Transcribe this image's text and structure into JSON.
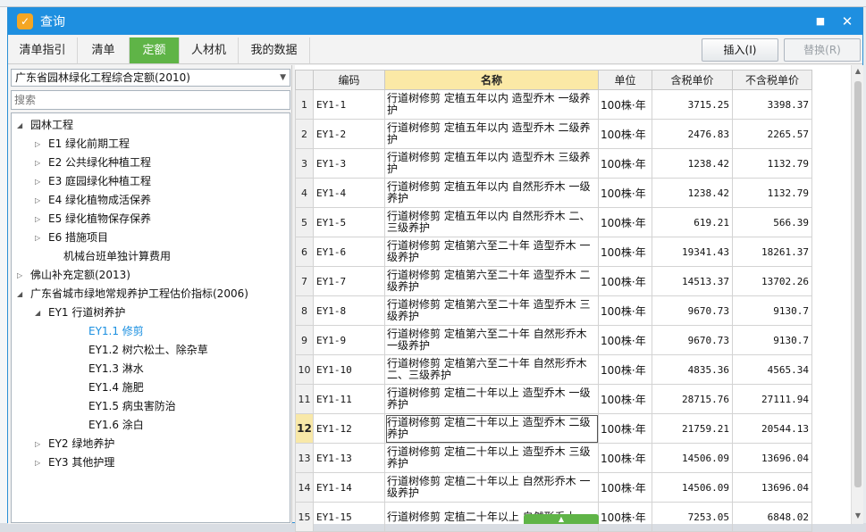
{
  "window": {
    "title": "查询",
    "minimize_glyph": "■",
    "close_glyph": "✕",
    "icon_glyph": "✓"
  },
  "tabs": [
    "清单指引",
    "清单",
    "定额",
    "人材机",
    "我的数据"
  ],
  "active_tab": 2,
  "buttons": {
    "insert": "插入(I)",
    "replace": "替换(R)"
  },
  "library": {
    "selected": "广东省园林绿化工程综合定额(2010)"
  },
  "search": {
    "placeholder": "搜索"
  },
  "tree": [
    {
      "label": "园林工程",
      "level": 0,
      "arrow": "◢"
    },
    {
      "label": "E1 绿化前期工程",
      "level": 1,
      "arrow": "▷"
    },
    {
      "label": "E2 公共绿化种植工程",
      "level": 1,
      "arrow": "▷"
    },
    {
      "label": "E3 庭园绿化种植工程",
      "level": 1,
      "arrow": "▷"
    },
    {
      "label": "E4 绿化植物成活保养",
      "level": 1,
      "arrow": "▷"
    },
    {
      "label": "E5 绿化植物保存保养",
      "level": 1,
      "arrow": "▷"
    },
    {
      "label": "E6 措施项目",
      "level": 1,
      "arrow": "▷"
    },
    {
      "label": "机械台班单独计算费用",
      "level": 1,
      "arrow": ""
    },
    {
      "label": "佛山补充定额(2013)",
      "level": 0,
      "arrow": "▷"
    },
    {
      "label": "广东省城市绿地常规养护工程估价指标(2006)",
      "level": 0,
      "arrow": "◢"
    },
    {
      "label": "EY1 行道树养护",
      "level": 1,
      "arrow": "◢"
    },
    {
      "label": "EY1.1 修剪",
      "level": 2,
      "arrow": "",
      "selected": true
    },
    {
      "label": "EY1.2 树穴松土、除杂草",
      "level": 2,
      "arrow": ""
    },
    {
      "label": "EY1.3 淋水",
      "level": 2,
      "arrow": ""
    },
    {
      "label": "EY1.4 施肥",
      "level": 2,
      "arrow": ""
    },
    {
      "label": "EY1.5 病虫害防治",
      "level": 2,
      "arrow": ""
    },
    {
      "label": "EY1.6 涂白",
      "level": 2,
      "arrow": ""
    },
    {
      "label": "EY2 绿地养护",
      "level": 1,
      "arrow": "▷"
    },
    {
      "label": "EY3 其他护理",
      "level": 1,
      "arrow": "▷"
    }
  ],
  "grid": {
    "headers": {
      "code": "编码",
      "name": "名称",
      "unit": "单位",
      "tax_price": "含税单价",
      "notax_price": "不含税单价"
    },
    "current_row": 12,
    "rows": [
      {
        "n": "1",
        "code": "EY1-1",
        "name": "行道树修剪 定植五年以内 造型乔木 一级养护",
        "unit": "100株·年",
        "tax": "3715.25",
        "notax": "3398.37"
      },
      {
        "n": "2",
        "code": "EY1-2",
        "name": "行道树修剪 定植五年以内 造型乔木 二级养护",
        "unit": "100株·年",
        "tax": "2476.83",
        "notax": "2265.57"
      },
      {
        "n": "3",
        "code": "EY1-3",
        "name": "行道树修剪 定植五年以内 造型乔木 三级养护",
        "unit": "100株·年",
        "tax": "1238.42",
        "notax": "1132.79"
      },
      {
        "n": "4",
        "code": "EY1-4",
        "name": "行道树修剪 定植五年以内 自然形乔木 一级养护",
        "unit": "100株·年",
        "tax": "1238.42",
        "notax": "1132.79"
      },
      {
        "n": "5",
        "code": "EY1-5",
        "name": "行道树修剪 定植五年以内 自然形乔木 二、三级养护",
        "unit": "100株·年",
        "tax": "619.21",
        "notax": "566.39"
      },
      {
        "n": "6",
        "code": "EY1-6",
        "name": "行道树修剪 定植第六至二十年 造型乔木 一级养护",
        "unit": "100株·年",
        "tax": "19341.43",
        "notax": "18261.37"
      },
      {
        "n": "7",
        "code": "EY1-7",
        "name": "行道树修剪 定植第六至二十年 造型乔木 二级养护",
        "unit": "100株·年",
        "tax": "14513.37",
        "notax": "13702.26"
      },
      {
        "n": "8",
        "code": "EY1-8",
        "name": "行道树修剪 定植第六至二十年 造型乔木 三级养护",
        "unit": "100株·年",
        "tax": "9670.73",
        "notax": "9130.7"
      },
      {
        "n": "9",
        "code": "EY1-9",
        "name": "行道树修剪 定植第六至二十年 自然形乔木 一级养护",
        "unit": "100株·年",
        "tax": "9670.73",
        "notax": "9130.7"
      },
      {
        "n": "10",
        "code": "EY1-10",
        "name": "行道树修剪 定植第六至二十年 自然形乔木 二、三级养护",
        "unit": "100株·年",
        "tax": "4835.36",
        "notax": "4565.34"
      },
      {
        "n": "11",
        "code": "EY1-11",
        "name": "行道树修剪 定植二十年以上 造型乔木 一级养护",
        "unit": "100株·年",
        "tax": "28715.76",
        "notax": "27111.94"
      },
      {
        "n": "12",
        "code": "EY1-12",
        "name": "行道树修剪 定植二十年以上 造型乔木 二级养护",
        "unit": "100株·年",
        "tax": "21759.21",
        "notax": "20544.13"
      },
      {
        "n": "13",
        "code": "EY1-13",
        "name": "行道树修剪 定植二十年以上 造型乔木 三级养护",
        "unit": "100株·年",
        "tax": "14506.09",
        "notax": "13696.04"
      },
      {
        "n": "14",
        "code": "EY1-14",
        "name": "行道树修剪 定植二十年以上 自然形乔木 一级养护",
        "unit": "100株·年",
        "tax": "14506.09",
        "notax": "13696.04"
      },
      {
        "n": "15",
        "code": "EY1-15",
        "name": "行道树修剪 定植二十年以上 自然形乔木",
        "unit": "100株·年",
        "tax": "7253.05",
        "notax": "6848.02"
      }
    ]
  },
  "splitter_glyph": "▲"
}
